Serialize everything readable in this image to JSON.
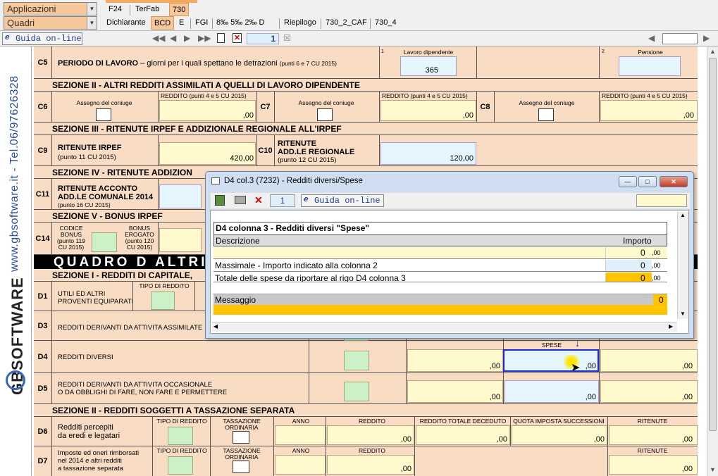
{
  "menu": {
    "combo1": "Applicazioni",
    "combo2": "Quadri",
    "tabs_row1": [
      "F24",
      "TerFab",
      "730"
    ],
    "tabs_row2": [
      "Dichiarante",
      "BCD",
      "E",
      "FGI",
      "8‰ 5‰ 2‰ D",
      "Riepilogo",
      "730_2_CAF",
      "730_4"
    ]
  },
  "toolbar": {
    "guida": "Guida on-line",
    "page": "1"
  },
  "brand": {
    "phone": "www.gbsoftware.it - Tel.06/97626328",
    "logo": "GBSOFTWARE"
  },
  "form": {
    "c5": {
      "code": "C5",
      "label": "PERIODO DI LAVORO",
      "desc": " – giorni per i quali spettano le detrazioni",
      "ref": "(punti 6 e 7 CU 2015)",
      "col1_label": "Lavoro dipendente",
      "col1_value": "365",
      "col2_label": "Pensione"
    },
    "sec2": "SEZIONE II  -  ALTRI REDDITI ASSIMILATI A QUELLI DI LAVORO DIPENDENTE",
    "c6": {
      "code": "C6",
      "assegno": "Assegno del coniuge",
      "reddito": "REDDITO (punti 4 e 5 CU 2015)",
      "val": ",00"
    },
    "c7": {
      "code": "C7",
      "assegno": "Assegno del coniuge",
      "reddito": "REDDITO (punti 4 e 5 CU 2015)",
      "val": ",00"
    },
    "c8": {
      "code": "C8",
      "assegno": "Assegno del coniuge",
      "reddito": "REDDITO (punti 4 e 5 CU 2015)",
      "val": ",00"
    },
    "sec3": "SEZIONE III  -  RITENUTE IRPEF E ADDIZIONALE REGIONALE ALL'IRPEF",
    "c9": {
      "code": "C9",
      "label": "RITENUTE IRPEF",
      "ref": "(punto 11 CU 2015)",
      "val": "420,00"
    },
    "c10": {
      "code": "C10",
      "label1": "RITENUTE",
      "label2": "ADD.LE REGIONALE",
      "ref": "(punto 12 CU 2015)",
      "val": "120,00"
    },
    "sec4": "SEZIONE IV  -  RITENUTE ADDIZION",
    "c11": {
      "code": "C11",
      "label1": "RITENUTE ACCONTO",
      "label2": "ADD.LE COMUNALE 2014",
      "ref": "(punto 16 CU 2015)"
    },
    "sec5": "SEZIONE V  -  BONUS IRPEF",
    "c14": {
      "code": "C14",
      "codice": "CODICE BONUS (punto 119 CU 2015)",
      "bonus": "BONUS EROGATO (punto 120 CU 2015)"
    },
    "quadro_d": "QUADRO  D   ALTRI R",
    "secd1": "SEZIONE I - REDDITI DI CAPITALE,",
    "d1": {
      "code": "D1",
      "label1": "UTILI ED ALTRI",
      "label2": "PROVENTI EQUIPARATI",
      "tipo": "TIPO DI REDDITO"
    },
    "d3": {
      "code": "D3",
      "label": "REDDITI DERIVANTI DA ATTIVITA ASSIMILATE"
    },
    "d4": {
      "code": "D4",
      "label": "REDDITI DIVERSI",
      "spese": "SPESE",
      "v1": ",00",
      "v2": ",00",
      "v3": ",00"
    },
    "d5": {
      "code": "D5",
      "label1": "REDDITI DERIVANTI DA ATTIVITA OCCASIONALE",
      "label2": "O DA OBBLIGHI DI FARE, NON FARE E PERMETTERE",
      "v1": ",00",
      "v2": ",00",
      "v3": ",00"
    },
    "secd2": "SEZIONE II  -  REDDITI SOGGETTI A TASSAZIONE SEPARATA",
    "d6": {
      "code": "D6",
      "label1": "Redditi percepiti",
      "label2": "da eredi e legatari",
      "tipo": "TIPO DI REDDITO",
      "tass": "TASSAZIONE ORDINARIA",
      "anno": "ANNO",
      "reddito": "REDDITO",
      "totale": "REDDITO TOTALE DECEDUTO",
      "quota": "QUOTA IMPOSTA SUCCESSIONI",
      "ritenute": "RITENUTE",
      "val": ",00"
    },
    "d7": {
      "code": "D7",
      "label1": "Imposte ed oneri rimborsati",
      "label2": "nel 2014 e altri redditi",
      "label3": "a tassazione separata",
      "tipo": "TIPO DI REDDITO",
      "tass": "TASSAZIONE ORDINARIA",
      "anno": "ANNO",
      "reddito": "REDDITO",
      "ritenute": "RITENUTE",
      "val": ",00"
    }
  },
  "dialog": {
    "title": "D4 col.3 (7232) - Redditi diversi/Spese",
    "page": "1",
    "guida": "Guida on-line",
    "heading": "D4 colonna 3 - Redditi diversi \"Spese\"",
    "col_desc": "Descrizione",
    "col_importo": "Importo",
    "rows": [
      {
        "desc": "",
        "value": "0",
        "dec": ",00"
      },
      {
        "desc": "Massimale - Importo indicato alla colonna 2",
        "value": "0",
        "dec": ",00"
      },
      {
        "desc": "Totale delle spese da riportare al rigo D4 colonna 3",
        "value": "0",
        "dec": ",00"
      }
    ],
    "messaggio": "Messaggio",
    "messaggio_value": "0"
  }
}
